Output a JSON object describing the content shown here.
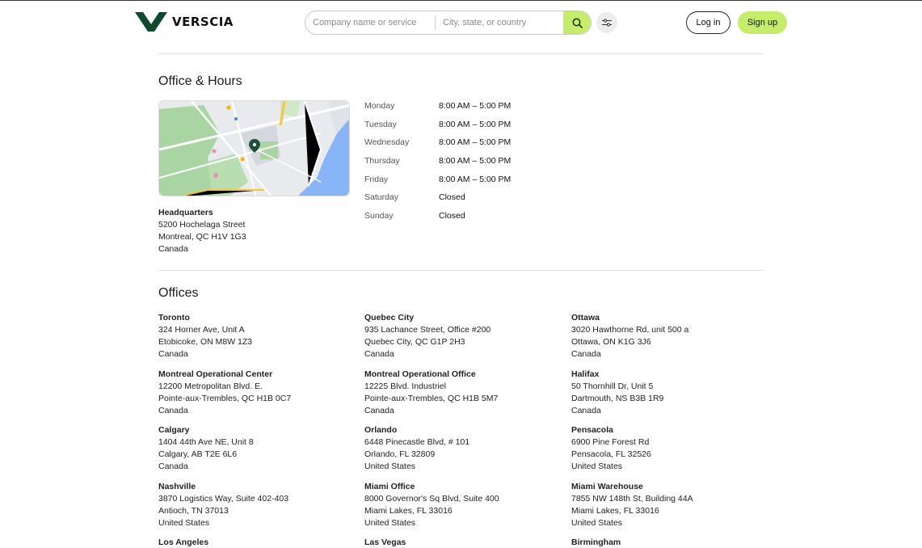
{
  "header": {
    "brand": "VERSCIA",
    "search_company_placeholder": "Company name or service",
    "search_location_placeholder": "City, state, or country",
    "login_label": "Log in",
    "signup_label": "Sign up"
  },
  "colors": {
    "accent": "#c5ec6b",
    "brand_green": "#0f4a2c"
  },
  "office_hours": {
    "title": "Office & Hours",
    "headquarters": {
      "label": "Headquarters",
      "line1": "5200 Hochelaga Street",
      "line2": "Montreal, QC H1V 1G3",
      "country": "Canada"
    },
    "hours": [
      {
        "day": "Monday",
        "time": "8:00 AM – 5:00 PM"
      },
      {
        "day": "Tuesday",
        "time": "8:00 AM – 5:00 PM"
      },
      {
        "day": "Wednesday",
        "time": "8:00 AM – 5:00 PM"
      },
      {
        "day": "Thursday",
        "time": "8:00 AM – 5:00 PM"
      },
      {
        "day": "Friday",
        "time": "8:00 AM – 5:00 PM"
      },
      {
        "day": "Saturday",
        "time": "Closed"
      },
      {
        "day": "Sunday",
        "time": "Closed"
      }
    ]
  },
  "offices": {
    "title": "Offices",
    "items": [
      {
        "name": "Toronto",
        "line1": "324 Horner Ave, Unit A",
        "line2": "Etobicoke, ON M8W 1Z3",
        "country": "Canada"
      },
      {
        "name": "Quebec City",
        "line1": "935 Lachance Street, Office #200",
        "line2": "Quebec City, QC G1P 2H3",
        "country": "Canada"
      },
      {
        "name": "Ottawa",
        "line1": "3020 Hawthorne Rd, unit 500 a",
        "line2": "Ottawa, ON K1G 3J6",
        "country": "Canada"
      },
      {
        "name": "Montreal Operational Center",
        "line1": "12200 Metropolitan Blvd. E.",
        "line2": "Pointe-aux-Trembles, QC H1B 0C7",
        "country": "Canada"
      },
      {
        "name": "Montreal Operational Office",
        "line1": "12225 Blvd. Industriel",
        "line2": "Pointe-aux-Trembles, QC H1B 5M7",
        "country": "Canada"
      },
      {
        "name": "Halifax",
        "line1": "50 Thornhill Dr, Unit 5",
        "line2": "Dartmouth, NS B3B 1R9",
        "country": "Canada"
      },
      {
        "name": "Calgary",
        "line1": "1404 44th Ave NE, Unit 8",
        "line2": "Calgary, AB T2E 6L6",
        "country": "Canada"
      },
      {
        "name": "Orlando",
        "line1": "6448 Pinecastle Blvd, # 101",
        "line2": "Orlando, FL 32809",
        "country": "United States"
      },
      {
        "name": "Pensacola",
        "line1": "6900 Pine Forest Rd",
        "line2": "Pensacola, FL 32526",
        "country": "United States"
      },
      {
        "name": "Nashville",
        "line1": "3870 Logistics Way, Suite 402-403",
        "line2": "Antioch, TN 37013",
        "country": "United States"
      },
      {
        "name": "Miami Office",
        "line1": "8000 Governor's Sq Blvd, Suite 400",
        "line2": "Miami Lakes, FL 33016",
        "country": "United States"
      },
      {
        "name": "Miami Warehouse",
        "line1": "7855 NW 148th St, Building 44A",
        "line2": "Miami Lakes, FL 33016",
        "country": "United States"
      },
      {
        "name": "Los Angeles",
        "line1": "",
        "line2": "",
        "country": ""
      },
      {
        "name": "Las Vegas",
        "line1": "",
        "line2": "",
        "country": ""
      },
      {
        "name": "Birmingham",
        "line1": "",
        "line2": "",
        "country": ""
      }
    ]
  }
}
